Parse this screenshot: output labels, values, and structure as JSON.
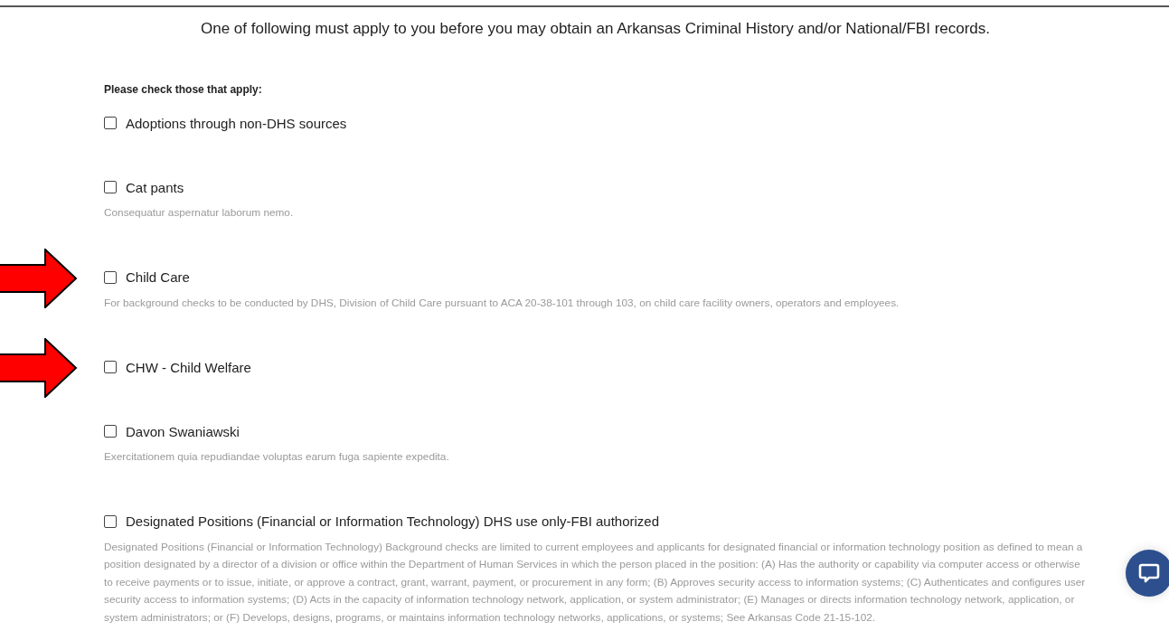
{
  "intro": "One of following must apply to you before you may obtain an Arkansas Criminal History and/or National/FBI records.",
  "prompt": "Please check those that apply:",
  "options": [
    {
      "label": "Adoptions through non-DHS sources",
      "checked": false,
      "arrow": false
    },
    {
      "label": "Cat pants",
      "checked": false,
      "arrow": false,
      "description": "Consequatur aspernatur laborum nemo."
    },
    {
      "label": "Child Care",
      "checked": false,
      "arrow": true,
      "description": "For background checks to be conducted by DHS, Division of Child Care pursuant to ACA 20-38-101 through 103, on child care facility owners, operators and employees."
    },
    {
      "label": "CHW - Child Welfare",
      "checked": false,
      "arrow": true
    },
    {
      "label": "Davon Swaniawski",
      "checked": false,
      "arrow": false,
      "description": "Exercitationem quia repudiandae voluptas earum fuga sapiente expedita."
    },
    {
      "label": "Designated Positions (Financial or Information Technology) DHS use only-FBI authorized",
      "checked": false,
      "arrow": false,
      "description": "Designated Positions (Financial or Information Technology) Background checks are limited to current employees and applicants for designated financial or information technology position as defined to mean a position designated by a director of a division or office within the Department of Human Services in which the person placed in the position: (A) Has the authority or capability via computer access or otherwise to receive payments or to issue, initiate, or approve a contract, grant, warrant, payment, or procurement in any form; (B) Approves security access to information systems; (C) Authenticates and configures user security access to information systems; (D) Acts in the capacity of information technology network, application, or system administrator; (E) Manages or directs information technology network, application, or system administrators; or (F) Develops, designs, programs, or maintains information technology networks, applications, or systems; See Arkansas Code 21-15-102."
    }
  ]
}
